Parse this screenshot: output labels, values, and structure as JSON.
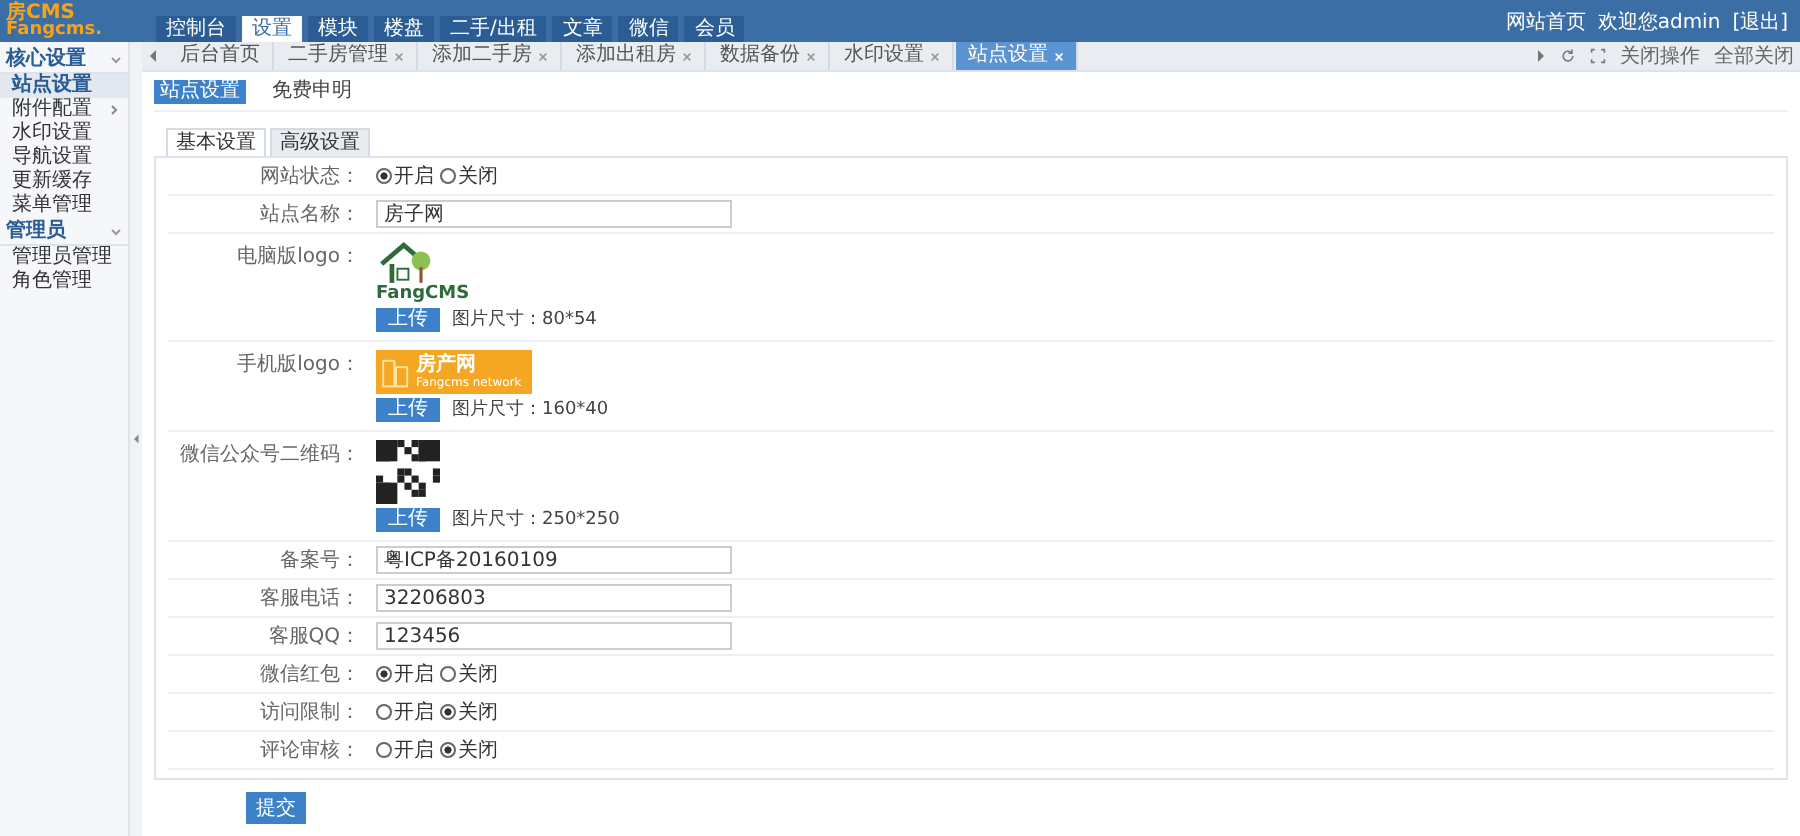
{
  "logo": {
    "top": "房CMS",
    "bottom": "Fangcms."
  },
  "nav": [
    {
      "label": "控制台",
      "selected": false
    },
    {
      "label": "设置",
      "selected": true
    },
    {
      "label": "模块",
      "selected": false
    },
    {
      "label": "楼盘",
      "selected": false
    },
    {
      "label": "二手/出租",
      "selected": false
    },
    {
      "label": "文章",
      "selected": false
    },
    {
      "label": "微信",
      "selected": false
    },
    {
      "label": "会员",
      "selected": false
    }
  ],
  "user_links": [
    "网站首页",
    "欢迎您admin",
    "[退出]"
  ],
  "sidebar": [
    {
      "title": "核心设置",
      "expanded": true,
      "items": [
        {
          "label": "站点设置",
          "selected": true,
          "has_arrow": false
        },
        {
          "label": "附件配置",
          "selected": false,
          "has_arrow": true
        },
        {
          "label": "水印设置",
          "selected": false,
          "has_arrow": false
        },
        {
          "label": "导航设置",
          "selected": false,
          "has_arrow": false
        },
        {
          "label": "更新缓存",
          "selected": false,
          "has_arrow": false
        },
        {
          "label": "菜单管理",
          "selected": false,
          "has_arrow": false
        }
      ]
    },
    {
      "title": "管理员",
      "expanded": true,
      "items": [
        {
          "label": "管理员管理",
          "selected": false,
          "has_arrow": false
        },
        {
          "label": "角色管理",
          "selected": false,
          "has_arrow": false
        }
      ]
    }
  ],
  "page_tabs": [
    {
      "label": "后台首页",
      "closable": false,
      "selected": false
    },
    {
      "label": "二手房管理",
      "closable": true,
      "selected": false
    },
    {
      "label": "添加二手房",
      "closable": true,
      "selected": false
    },
    {
      "label": "添加出租房",
      "closable": true,
      "selected": false
    },
    {
      "label": "数据备份",
      "closable": true,
      "selected": false
    },
    {
      "label": "水印设置",
      "closable": true,
      "selected": false
    },
    {
      "label": "站点设置",
      "closable": true,
      "selected": true
    }
  ],
  "tab_actions": [
    "关闭操作",
    "全部关闭"
  ],
  "sub_header": [
    {
      "label": "站点设置",
      "selected": true
    },
    {
      "label": "免费申明",
      "selected": false
    }
  ],
  "form_tabs": [
    {
      "label": "基本设置",
      "selected": true
    },
    {
      "label": "高级设置",
      "selected": false
    }
  ],
  "rows": [
    {
      "kind": "radio",
      "label": "网站状态：",
      "options": [
        {
          "label": "开启",
          "selected": true
        },
        {
          "label": "关闭",
          "selected": false
        }
      ]
    },
    {
      "kind": "text",
      "label": "站点名称：",
      "value": "房子网"
    },
    {
      "kind": "logo_pc",
      "label": "电脑版logo：",
      "logo_text": "FangCMS",
      "button": "上传",
      "hint": "图片尺寸：80*54"
    },
    {
      "kind": "logo_mobile",
      "label": "手机版logo：",
      "logo_text": "房产网",
      "logo_subtext": "Fangcms network",
      "button": "上传",
      "hint": "图片尺寸：160*40"
    },
    {
      "kind": "qr",
      "label": "微信公众号二维码：",
      "button": "上传",
      "hint": "图片尺寸：250*250"
    },
    {
      "kind": "text",
      "label": "备案号：",
      "value": "粤ICP备20160109"
    },
    {
      "kind": "text",
      "label": "客服电话：",
      "value": "32206803"
    },
    {
      "kind": "text",
      "label": "客服QQ：",
      "value": "123456"
    },
    {
      "kind": "radio",
      "label": "微信红包：",
      "options": [
        {
          "label": "开启",
          "selected": true
        },
        {
          "label": "关闭",
          "selected": false
        }
      ]
    },
    {
      "kind": "radio",
      "label": "访问限制：",
      "options": [
        {
          "label": "开启",
          "selected": false
        },
        {
          "label": "关闭",
          "selected": true
        }
      ]
    },
    {
      "kind": "radio",
      "label": "评论审核：",
      "options": [
        {
          "label": "开启",
          "selected": false
        },
        {
          "label": "关闭",
          "selected": true
        }
      ]
    }
  ],
  "submit": "提交"
}
